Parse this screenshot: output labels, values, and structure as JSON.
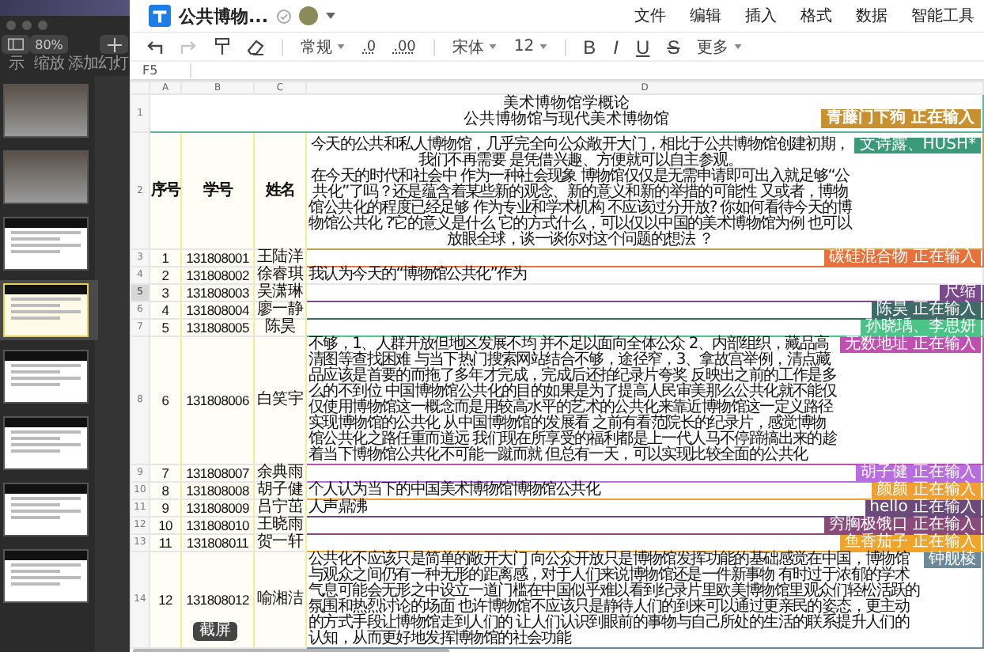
{
  "side_app": {
    "zoom": "80%",
    "toolbar": [
      {
        "kind": "layout",
        "label": "示"
      },
      {
        "kind": "zoom",
        "label": "缩放"
      },
      {
        "kind": "add",
        "label": "添加幻灯"
      }
    ],
    "slides": [
      {
        "kind": "photo",
        "selected": false
      },
      {
        "kind": "photo",
        "selected": false
      },
      {
        "kind": "text",
        "selected": false
      },
      {
        "kind": "text",
        "selected": true
      },
      {
        "kind": "text",
        "selected": false
      },
      {
        "kind": "text",
        "selected": false
      },
      {
        "kind": "text",
        "selected": false
      },
      {
        "kind": "text",
        "selected": false
      }
    ]
  },
  "document": {
    "title": "公共博物...",
    "menu": [
      "文件",
      "编辑",
      "插入",
      "格式",
      "数据",
      "智能工具"
    ]
  },
  "toolbar": [
    {
      "kind": "undo",
      "disabled": false
    },
    {
      "kind": "redo",
      "disabled": true
    },
    {
      "kind": "painter",
      "disabled": false
    },
    {
      "kind": "eraser",
      "disabled": false
    },
    {
      "kind": "sep"
    },
    {
      "kind": "dropdown",
      "label": "常规"
    },
    {
      "kind": "text",
      "label": ".0"
    },
    {
      "kind": "text",
      "label": ".00"
    },
    {
      "kind": "sep"
    },
    {
      "kind": "dropdown",
      "label": "宋体"
    },
    {
      "kind": "dropdown",
      "label": "12"
    },
    {
      "kind": "sep"
    },
    {
      "kind": "bold",
      "label": "B"
    },
    {
      "kind": "italic",
      "label": "I"
    },
    {
      "kind": "underline",
      "label": "U"
    },
    {
      "kind": "strike",
      "label": "S"
    },
    {
      "kind": "dropdown",
      "label": "更多"
    }
  ],
  "cell_ref": "F5",
  "columns": [
    "A",
    "B",
    "C",
    "D"
  ],
  "title_row": {
    "row": "1",
    "lines": [
      "美术博物馆学概论",
      "公共博物馆与现代美术博物馆"
    ],
    "collaborator": {
      "label": "青藤门下狗 正在输入",
      "color": "#c8902e"
    }
  },
  "header_row": {
    "row": "2",
    "cells": [
      "序号",
      "学号",
      "姓名"
    ],
    "prompt": [
      "今天的公共和私人博物馆，几乎完全向公众敞开大门，相比于公共博物馆创建初期，我们不再需要 是凭借兴趣、方便就可以自主参观。",
      "在今天的时代和社会中 作为一种社会现象 博物馆仅仅是无需申请即可出入就足够“公共化”了吗？还是蕴含着某些新的观念、新的意义和新的举措的可能性 又或者，博物馆公共化的程度已经足够 作为专业和学术机构 不应该过分开放? 你如何看待今天的博物馆公共化 ?它的意义是什么 它的方式什么，可以仅以中国的美术博物馆为例 也可以放眼全球，谈一谈你对这个问题的想法 ？"
    ],
    "collaborator": {
      "label": "文诗露、HUSH*",
      "color": "#3a9a7a"
    }
  },
  "rows": [
    {
      "row": "3",
      "no": "1",
      "id": "131808001",
      "name": "王陆洋",
      "selected": false,
      "collaborator": {
        "label": "碳硅混合物 正在输入",
        "color": "#e8703a"
      }
    },
    {
      "row": "4",
      "no": "2",
      "id": "131808002",
      "name": "徐睿琪",
      "answer": "我认为今天的“博物馆公共化”作为",
      "selected": false
    },
    {
      "row": "5",
      "no": "3",
      "id": "131808003",
      "name": "吴潇琳",
      "selected": true,
      "collaborator": {
        "label": "尺缩",
        "color": "#7a4a8a"
      }
    },
    {
      "row": "6",
      "no": "4",
      "id": "131808004",
      "name": "廖一静",
      "selected": false,
      "collaborator": {
        "label": "陈昊 正在输入",
        "color": "#3e6a68"
      }
    },
    {
      "row": "7",
      "no": "5",
      "id": "131808005",
      "name": "陈昊",
      "selected": false,
      "collaborator": {
        "label": "孙晓瑀、李思妍",
        "color": "#4cc488"
      }
    },
    {
      "row": "8",
      "no": "6",
      "id": "131808006",
      "name": "白笑宇",
      "answer": "不够，1、人群开放但地区发展不均 并不足以面向全体公众 2、内部组织，藏品高清图等查找困难 与当下热门搜索网站结合不够，途径窄，3、拿故宫举例，清点藏品应该是首要的而拖了多年才完成，完成后还拍纪录片夸奖 反映出之前的工作是多么的不到位 中国博物馆公共化的目的如果是为了提高人民审美那么公共化就不能仅仅使用博物馆这一概念而是用较高水平的艺术的公共化来靠近博物馆这一定义路径实现博物馆的公共化 从中国博物馆的发展看 之前有看范院长的纪录片，感觉博物馆公共化之路任重而道远 我们现在所享受的福利都是上一代人马不停蹄搞出来的趁着当下博物馆公共化不可能一蹴而就 但总有一天，可以实现比较全面的公共化",
      "selected": false,
      "collaborator": {
        "label": "无数地址 正在输入",
        "color": "#c050b0"
      }
    },
    {
      "row": "9",
      "no": "7",
      "id": "131808007",
      "name": "余典雨",
      "selected": false,
      "collaborator": {
        "label": "胡子健 正在输入",
        "color": "#b86ee0"
      }
    },
    {
      "row": "10",
      "no": "8",
      "id": "131808008",
      "name": "胡子健",
      "answer": "个人认为当下的中国美术博物馆博物馆公共化",
      "selected": false,
      "collaborator": {
        "label": "颜颜 正在输入",
        "color": "#f0a030"
      }
    },
    {
      "row": "11",
      "no": "9",
      "id": "131808009",
      "name": "吕宁茁",
      "answer": "人声鼎沸",
      "selected": false,
      "collaborator": {
        "label": "hello 正在输入",
        "color": "#6a4a7a"
      }
    },
    {
      "row": "12",
      "no": "10",
      "id": "131808010",
      "name": "王晓雨",
      "selected": false,
      "collaborator": {
        "label": "穷胸极饿口 正在输入",
        "color": "#8a4a7a"
      }
    },
    {
      "row": "13",
      "no": "11",
      "id": "131808011",
      "name": "贺一轩",
      "selected": false,
      "collaborator": {
        "label": "鱼香茄子 正在输入",
        "color": "#f0a428"
      }
    },
    {
      "row": "14",
      "no": "12",
      "id": "131808012",
      "name": "喻湘洁",
      "answer": "公共化不应该只是简单的敞开大门 向公众开放只是博物馆发挥功能的基础感觉在中国，博物馆与观众之间仍有一种无形的距离感，对于人们来说博物馆还是一件新事物 有时过于浓郁的学术气息可能会无形之中设立一道门槛在中国似乎难以看到纪录片里欧美博物馆里观众们轻松活跃的氛围和热烈讨论的场面 也许博物馆不应该只是静待人们的到来可以通过更亲民的姿态，更主动的方式手段让博物馆走到人们的 让人们认识到眼前的事物与自己所处的生活的联系提升人们的认知，从而更好地发挥博物馆的社会功能",
      "selected": false,
      "collaborator": {
        "label": "钟舰棱",
        "color": "#6a8a9a"
      }
    }
  ],
  "tooltip": "截屏"
}
